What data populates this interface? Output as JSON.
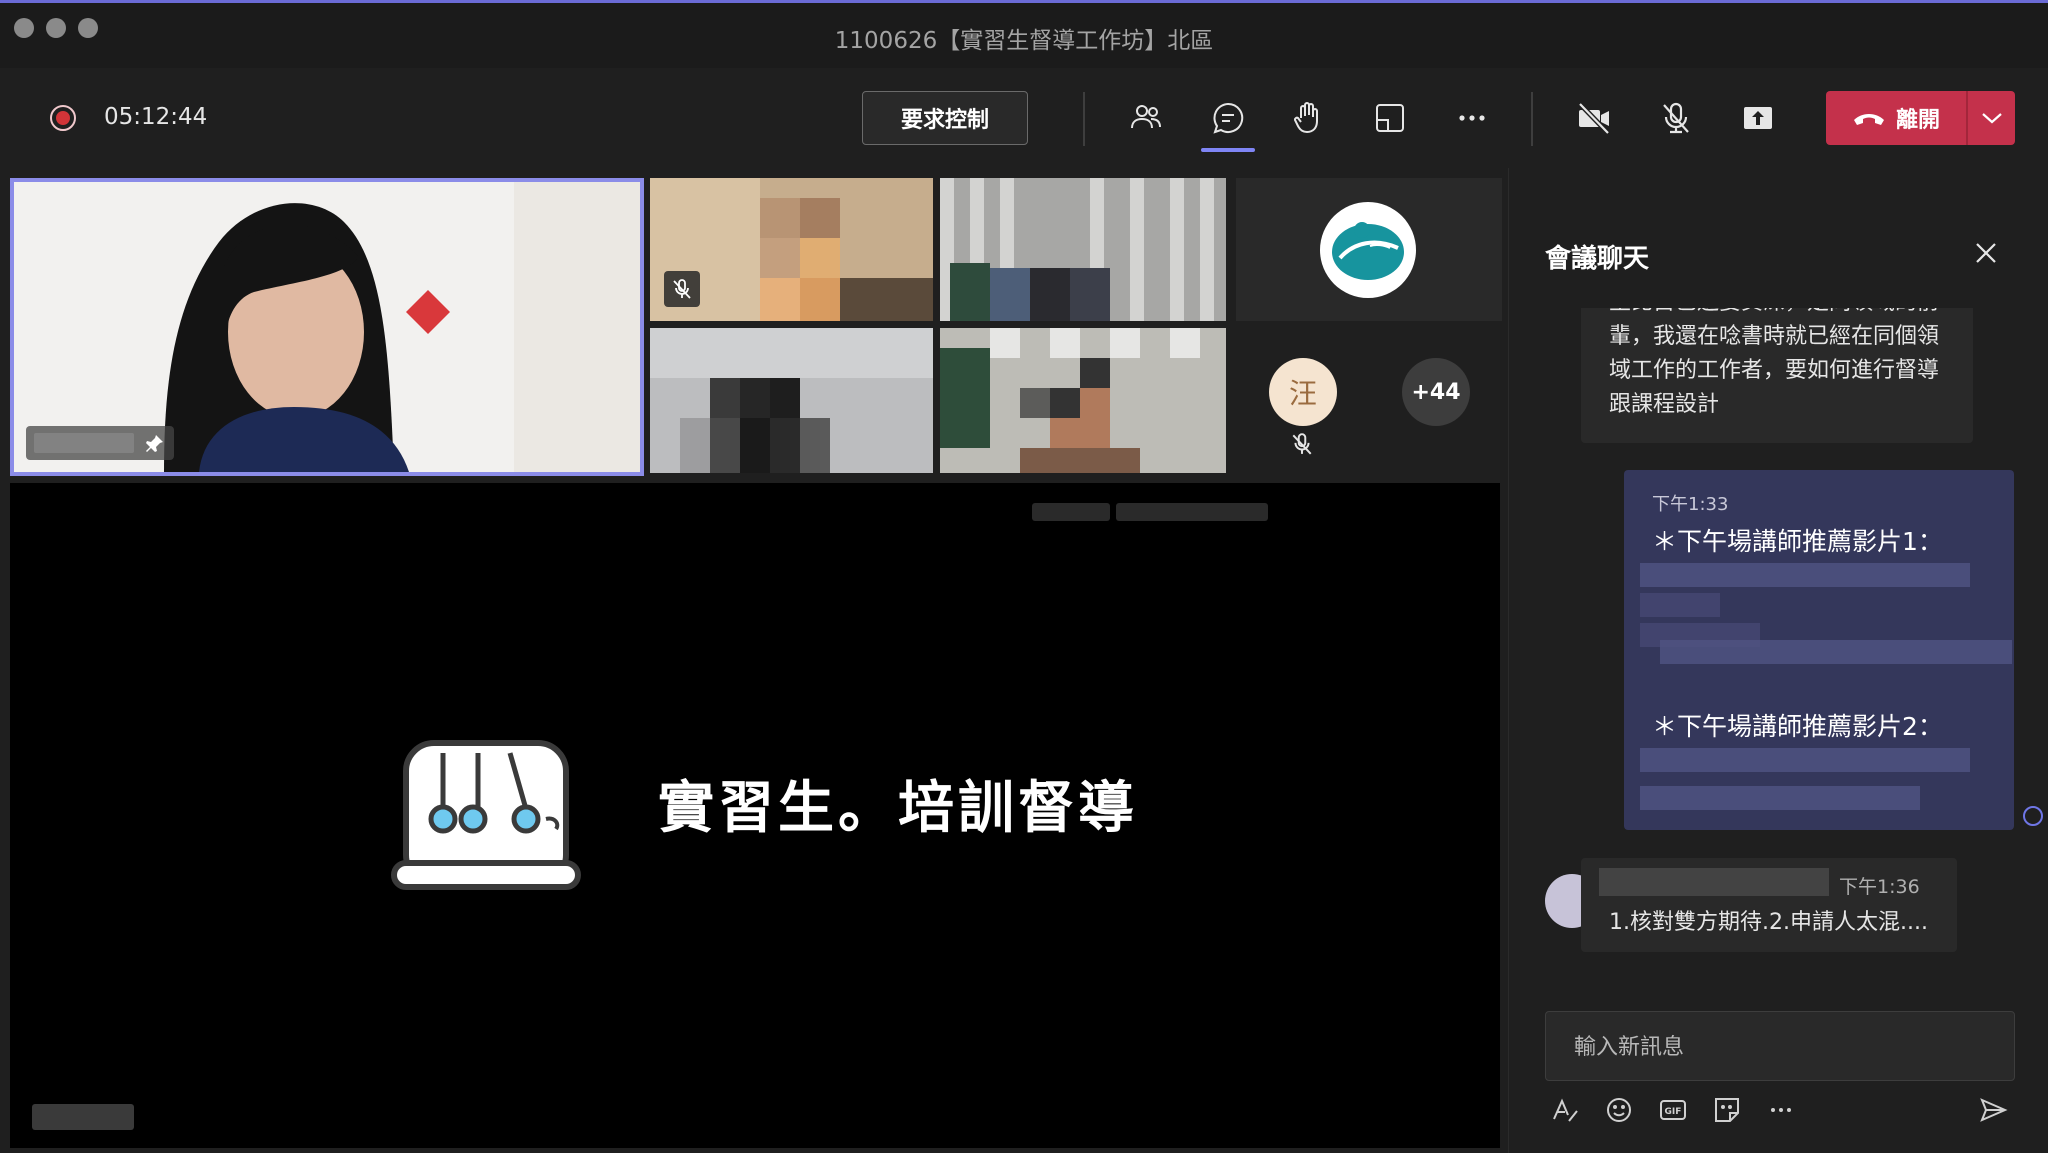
{
  "window": {
    "title": "1100626【實習生督導工作坊】北區"
  },
  "toolbar": {
    "timer": "05:12:44",
    "request_control_label": "要求控制",
    "leave_label": "離開"
  },
  "stage": {
    "avatar_initial": "汪",
    "more_count": "+44",
    "share_title": "實習生。培訓督導"
  },
  "chat": {
    "header": "會議聊天",
    "message1_text": "主比占已還要資深，是同領域的前輩，我還在唸書時就已經在同個領域工作的工作者，要如何進行督導跟課程設計",
    "my_message_time": "下午1:33",
    "my_message_line1": "＊下午場講師推薦影片1：",
    "my_message_line2": "＊下午場講師推薦影片2：",
    "message2_time": "下午1:36",
    "message2_text": "1.核對雙方期待.2.申請人太混....",
    "compose_placeholder": "輸入新訊息"
  },
  "colors": {
    "accent": "#7f85f5",
    "leave": "#c4314b",
    "recording": "#d13438",
    "pinned_border": "#8b8ce8"
  }
}
